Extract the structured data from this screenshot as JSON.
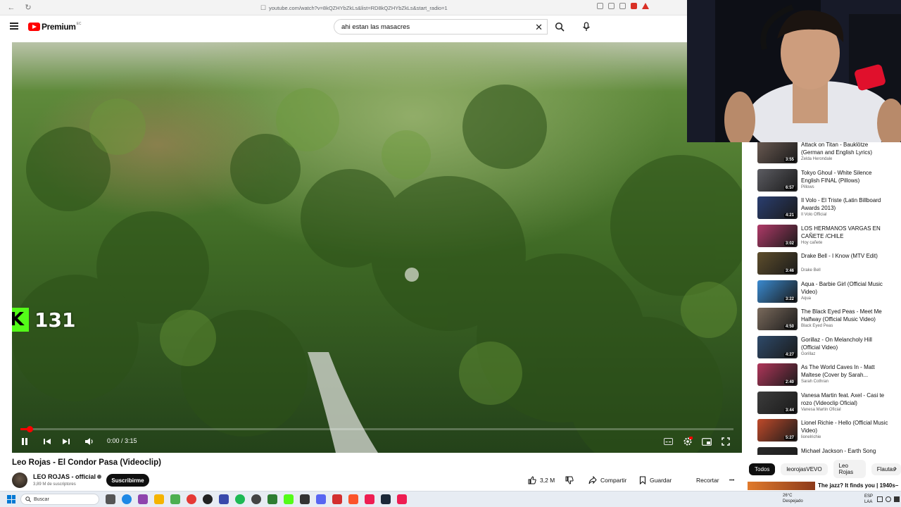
{
  "browser": {
    "url": "youtube.com/watch?v=8kQZHYbZkLs&list=RD8kQZHYbZkLs&start_radio=1"
  },
  "header": {
    "logo_text": "Premium",
    "logo_sup": "EC",
    "search_value": "ahi estan las masacres"
  },
  "player": {
    "time": "0:00 / 3:15",
    "progress": 0.013,
    "kick_count": "131"
  },
  "video": {
    "title": "Leo Rojas - El Condor Pasa (Videoclip)",
    "channel": "LEO ROJAS - official",
    "subscribers": "3,89 M de suscriptores",
    "subscribe_label": "Suscribirme",
    "likes": "3,2 M",
    "share_label": "Compartir",
    "save_label": "Guardar",
    "clip_label": "Recortar",
    "more_label": "•••"
  },
  "sidebar": {
    "items": [
      {
        "title": "Attack on Titan - Bauklötze (German and English Lyrics)",
        "channel": "Zelda Herondale",
        "duration": "3:55",
        "color": "#6a5a52"
      },
      {
        "title": "Tokyo Ghoul - White Silence English FINAL (Pillows)",
        "channel": "Pillows",
        "duration": "6:57",
        "color": "#5c5c62"
      },
      {
        "title": "Il Volo - El Triste (Latin Billboard Awards 2013)",
        "channel": "Il Volo Official",
        "duration": "4:21",
        "color": "#2a3e70"
      },
      {
        "title": "LOS HERMANOS VARGAS EN CAÑETE /CHILE",
        "channel": "Hoy cañete",
        "duration": "3:02",
        "color": "#b03a68"
      },
      {
        "title": "Drake Bell - I Know (MTV Edit)",
        "channel": "Drake Bell",
        "duration": "3:46",
        "color": "#5e4e2c"
      },
      {
        "title": "Aqua - Barbie Girl (Official Music Video)",
        "channel": "Aqua",
        "duration": "3:22",
        "color": "#3a8ad0"
      },
      {
        "title": "The Black Eyed Peas - Meet Me Halfway (Official Music Video)",
        "channel": "Black Eyed Peas",
        "duration": "4:50",
        "color": "#7a6a5c"
      },
      {
        "title": "Gorillaz - On Melancholy Hill (Official Video)",
        "channel": "Gorillaz",
        "duration": "4:27",
        "color": "#2e4a6a"
      },
      {
        "title": "As The World Caves In - Matt Maltese (Cover by Sarah...",
        "channel": "Sarah Cothran",
        "duration": "2:40",
        "color": "#b0365a"
      },
      {
        "title": "Vanesa Martin feat. Axel - Casi te rozo (Videoclip Oficial)",
        "channel": "Vanesa Martin Oficial",
        "duration": "3:44",
        "color": "#3c3c3c"
      },
      {
        "title": "Lionel Richie - Hello (Official Music Video)",
        "channel": "lionelrichie",
        "duration": "5:27",
        "color": "#c04a2a"
      },
      {
        "title": "Michael Jackson - Earth Song",
        "channel": "",
        "duration": "",
        "color": "#2a2a2a"
      }
    ]
  },
  "chips": [
    "Todos",
    "leorojasVEVO",
    "Leo Rojas",
    "Flautas"
  ],
  "next_item": {
    "title": "The jazz? It finds you | 1940s–"
  },
  "taskbar": {
    "search_placeholder": "Buscar",
    "weather_temp": "26°C",
    "weather_desc": "Despejado",
    "lang_top": "ESP",
    "lang_bottom": "LAA"
  }
}
